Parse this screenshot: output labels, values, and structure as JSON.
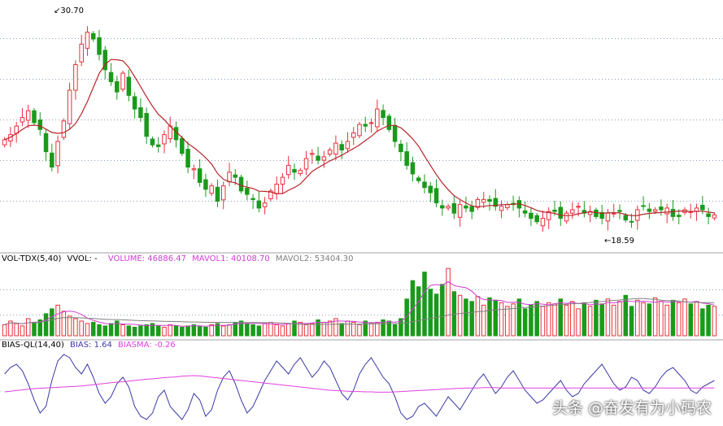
{
  "main_panel": {
    "header_text": "",
    "price_high_label": "30.70",
    "price_low_label": "18.59",
    "high_arrow_glyph": "↙",
    "low_arrow_glyph": "←"
  },
  "volume_panel": {
    "header": {
      "name": "VOL-TDX(5,40)",
      "vvol": "VVOL: -",
      "volume": "VOLUME: 46886.47",
      "mavol1": "MAVOL1: 40108.70",
      "mavol2": "MAVOL2: 53404.30"
    }
  },
  "bias_panel": {
    "header": {
      "name": "BIAS-QL(14,40)",
      "bias": "BIAS: 1.64",
      "biasma": "BIASMA: -0.26"
    }
  },
  "watermark": "头条 @奋发有为小码农",
  "colors": {
    "up": "#e8303a",
    "down": "#1a9a1a",
    "ma": "#b8242a",
    "grid": "#8aa0b8",
    "panel_border": "#a0a0a0",
    "volume_ma_short": "#d23cd2",
    "volume_ma_long": "#808080",
    "bias_line": "#3a3aa8",
    "bias_ma_line": "#e040e0",
    "header_text": "#000000"
  },
  "chart_data": [
    {
      "type": "candlestick",
      "title": "",
      "ylim": [
        17.5,
        31.5
      ],
      "price_high": 30.7,
      "price_low": 18.59,
      "close": [
        23.6,
        23.9,
        24.4,
        24.9,
        25.3,
        24.6,
        24.2,
        22.9,
        22.0,
        23.5,
        24.7,
        26.5,
        28.0,
        29.2,
        29.9,
        29.5,
        28.6,
        27.7,
        27.0,
        26.4,
        27.5,
        26.2,
        25.4,
        24.9,
        23.8,
        23.3,
        23.2,
        23.9,
        24.4,
        23.6,
        22.8,
        22.0,
        21.9,
        21.1,
        20.7,
        20.9,
        20.0,
        20.9,
        21.7,
        21.4,
        20.6,
        20.4,
        20.1,
        19.6,
        19.9,
        20.6,
        21.0,
        21.4,
        22.1,
        21.7,
        21.8,
        22.5,
        22.8,
        22.4,
        22.6,
        23.0,
        23.4,
        23.0,
        23.5,
        24.0,
        24.5,
        24.4,
        24.6,
        25.4,
        24.9,
        24.2,
        23.5,
        22.9,
        22.1,
        21.6,
        21.2,
        20.8,
        20.5,
        19.9,
        19.6,
        19.7,
        19.3,
        19.8,
        19.6,
        19.4,
        20.1,
        20.1,
        20.0,
        19.7,
        19.7,
        19.8,
        19.8,
        19.6,
        19.3,
        19.0,
        18.8,
        19.0,
        19.4,
        19.4,
        19.0,
        19.3,
        19.5,
        19.7,
        19.3,
        19.4,
        19.1,
        19.0,
        19.3,
        19.3,
        19.4,
        18.9,
        18.8,
        19.5,
        19.7,
        19.4,
        19.5,
        19.5,
        19.6,
        19.1,
        19.1,
        19.5,
        19.4,
        19.6,
        19.5,
        19.1,
        19.2
      ]
    },
    {
      "type": "bar",
      "title": "",
      "series_name": "VOL-TDX(5,40)",
      "volume": 46886.47,
      "mavol1": 40108.7,
      "mavol2": 53404.3,
      "values": [
        9,
        12,
        10,
        8,
        14,
        11,
        13,
        18,
        22,
        25,
        20,
        16,
        14,
        12,
        10,
        11,
        9,
        8,
        10,
        12,
        9,
        8,
        7,
        8,
        9,
        10,
        8,
        7,
        9,
        8,
        7,
        8,
        9,
        8,
        7,
        9,
        10,
        8,
        9,
        11,
        12,
        10,
        9,
        8,
        10,
        11,
        9,
        8,
        10,
        12,
        11,
        9,
        10,
        13,
        11,
        12,
        14,
        10,
        12,
        11,
        9,
        12,
        10,
        11,
        13,
        12,
        9,
        14,
        30,
        45,
        40,
        52,
        38,
        34,
        42,
        55,
        36,
        33,
        30,
        28,
        32,
        25,
        31,
        29,
        27,
        24,
        26,
        30,
        22,
        25,
        28,
        24,
        27,
        26,
        30,
        25,
        28,
        22,
        27,
        24,
        29,
        26,
        30,
        25,
        28,
        33,
        24,
        29,
        27,
        26,
        31,
        28,
        25,
        29,
        27,
        30,
        26,
        28,
        22,
        25,
        24
      ]
    },
    {
      "type": "line",
      "title": "",
      "series": [
        {
          "name": "BIAS",
          "value": 1.64,
          "values": [
            4,
            6,
            7,
            5,
            1,
            -4,
            -8,
            -6,
            2,
            8,
            10,
            9,
            6,
            4,
            7,
            3,
            -2,
            -5,
            -3,
            1,
            3,
            0,
            -6,
            -9,
            -10,
            -8,
            -3,
            -1,
            -6,
            -8,
            -10,
            -7,
            -2,
            -4,
            -9,
            -7,
            -1,
            3,
            5,
            1,
            -4,
            -8,
            -6,
            -2,
            2,
            5,
            8,
            6,
            4,
            7,
            9,
            6,
            3,
            5,
            8,
            6,
            2,
            -2,
            -4,
            -1,
            4,
            7,
            9,
            6,
            3,
            1,
            -3,
            -8,
            -10,
            -9,
            -6,
            -5,
            -7,
            -9,
            -6,
            -3,
            -5,
            -7,
            -4,
            -1,
            2,
            4,
            1,
            -2,
            0,
            3,
            5,
            2,
            -1,
            -3,
            -5,
            -4,
            -2,
            0,
            2,
            -1,
            -3,
            -2,
            1,
            3,
            5,
            7,
            4,
            1,
            -1,
            0,
            3,
            2,
            -1,
            -2,
            0,
            3,
            5,
            6,
            4,
            2,
            -1,
            -2,
            0,
            1,
            2
          ]
        },
        {
          "name": "BIASMA",
          "value": -0.26,
          "values": [
            -1.5,
            -1.3,
            -1.1,
            -0.9,
            -0.7,
            -0.5,
            -0.4,
            -0.3,
            -0.2,
            -0.1,
            0.0,
            0.1,
            0.2,
            0.3,
            0.5,
            0.7,
            0.9,
            1.1,
            1.3,
            1.5,
            1.6,
            1.8,
            2.0,
            2.2,
            2.4,
            2.5,
            2.7,
            2.9,
            3.0,
            3.1,
            3.3,
            3.4,
            3.5,
            3.4,
            3.2,
            3.0,
            2.8,
            2.6,
            2.4,
            2.2,
            2.0,
            1.8,
            1.6,
            1.4,
            1.2,
            1.0,
            0.8,
            0.6,
            0.4,
            0.2,
            0.0,
            -0.2,
            -0.4,
            -0.6,
            -0.8,
            -1.0,
            -1.1,
            -1.2,
            -1.3,
            -1.4,
            -1.4,
            -1.5,
            -1.5,
            -1.6,
            -1.6,
            -1.6,
            -1.5,
            -1.4,
            -1.3,
            -1.2,
            -1.1,
            -1.0,
            -0.9,
            -0.8,
            -0.7,
            -0.6,
            -0.5,
            -0.4,
            -0.3,
            -0.3,
            -0.3,
            -0.2,
            -0.2,
            -0.2,
            -0.3,
            -0.3,
            -0.3,
            -0.3,
            -0.3,
            -0.3,
            -0.3,
            -0.3,
            -0.3,
            -0.3,
            -0.3,
            -0.3,
            -0.3,
            -0.3,
            -0.3,
            -0.3,
            -0.3,
            -0.3,
            -0.3,
            -0.3,
            -0.3,
            -0.3,
            -0.3,
            -0.3,
            -0.3,
            -0.3,
            -0.3,
            -0.3,
            -0.3,
            -0.3,
            -0.3,
            -0.3,
            -0.3,
            -0.3,
            -0.3,
            -0.3,
            -0.3
          ]
        }
      ]
    }
  ]
}
